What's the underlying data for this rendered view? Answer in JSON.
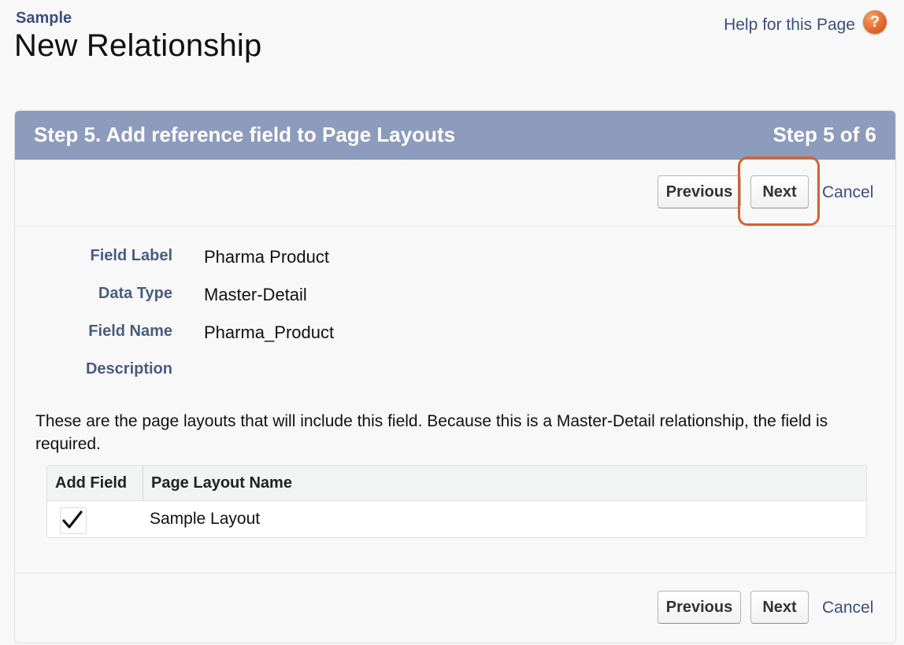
{
  "header": {
    "object_name": "Sample",
    "title": "New Relationship",
    "help_link": "Help for this Page",
    "help_icon": "?"
  },
  "wizard": {
    "step_title": "Step 5. Add reference field to Page Layouts",
    "step_count": "Step 5 of 6",
    "buttons": {
      "previous": "Previous",
      "next": "Next",
      "cancel": "Cancel"
    }
  },
  "fields": [
    {
      "label": "Field Label",
      "value": "Pharma Product"
    },
    {
      "label": "Data Type",
      "value": "Master-Detail"
    },
    {
      "label": "Field Name",
      "value": "Pharma_Product"
    },
    {
      "label": "Description",
      "value": ""
    }
  ],
  "info_text": "These are the page layouts that will include this field. Because this is a Master-Detail relationship, the field is required.",
  "layouts_table": {
    "headers": [
      "Add Field",
      "Page Layout Name"
    ],
    "rows": [
      {
        "checked": true,
        "name": "Sample Layout"
      }
    ]
  },
  "colors": {
    "panel_header": "#8d9bbc",
    "label_text": "#4a5c7e",
    "link": "#3b4f7c",
    "highlight": "#d4612e",
    "help_icon": "#e26b2a"
  }
}
